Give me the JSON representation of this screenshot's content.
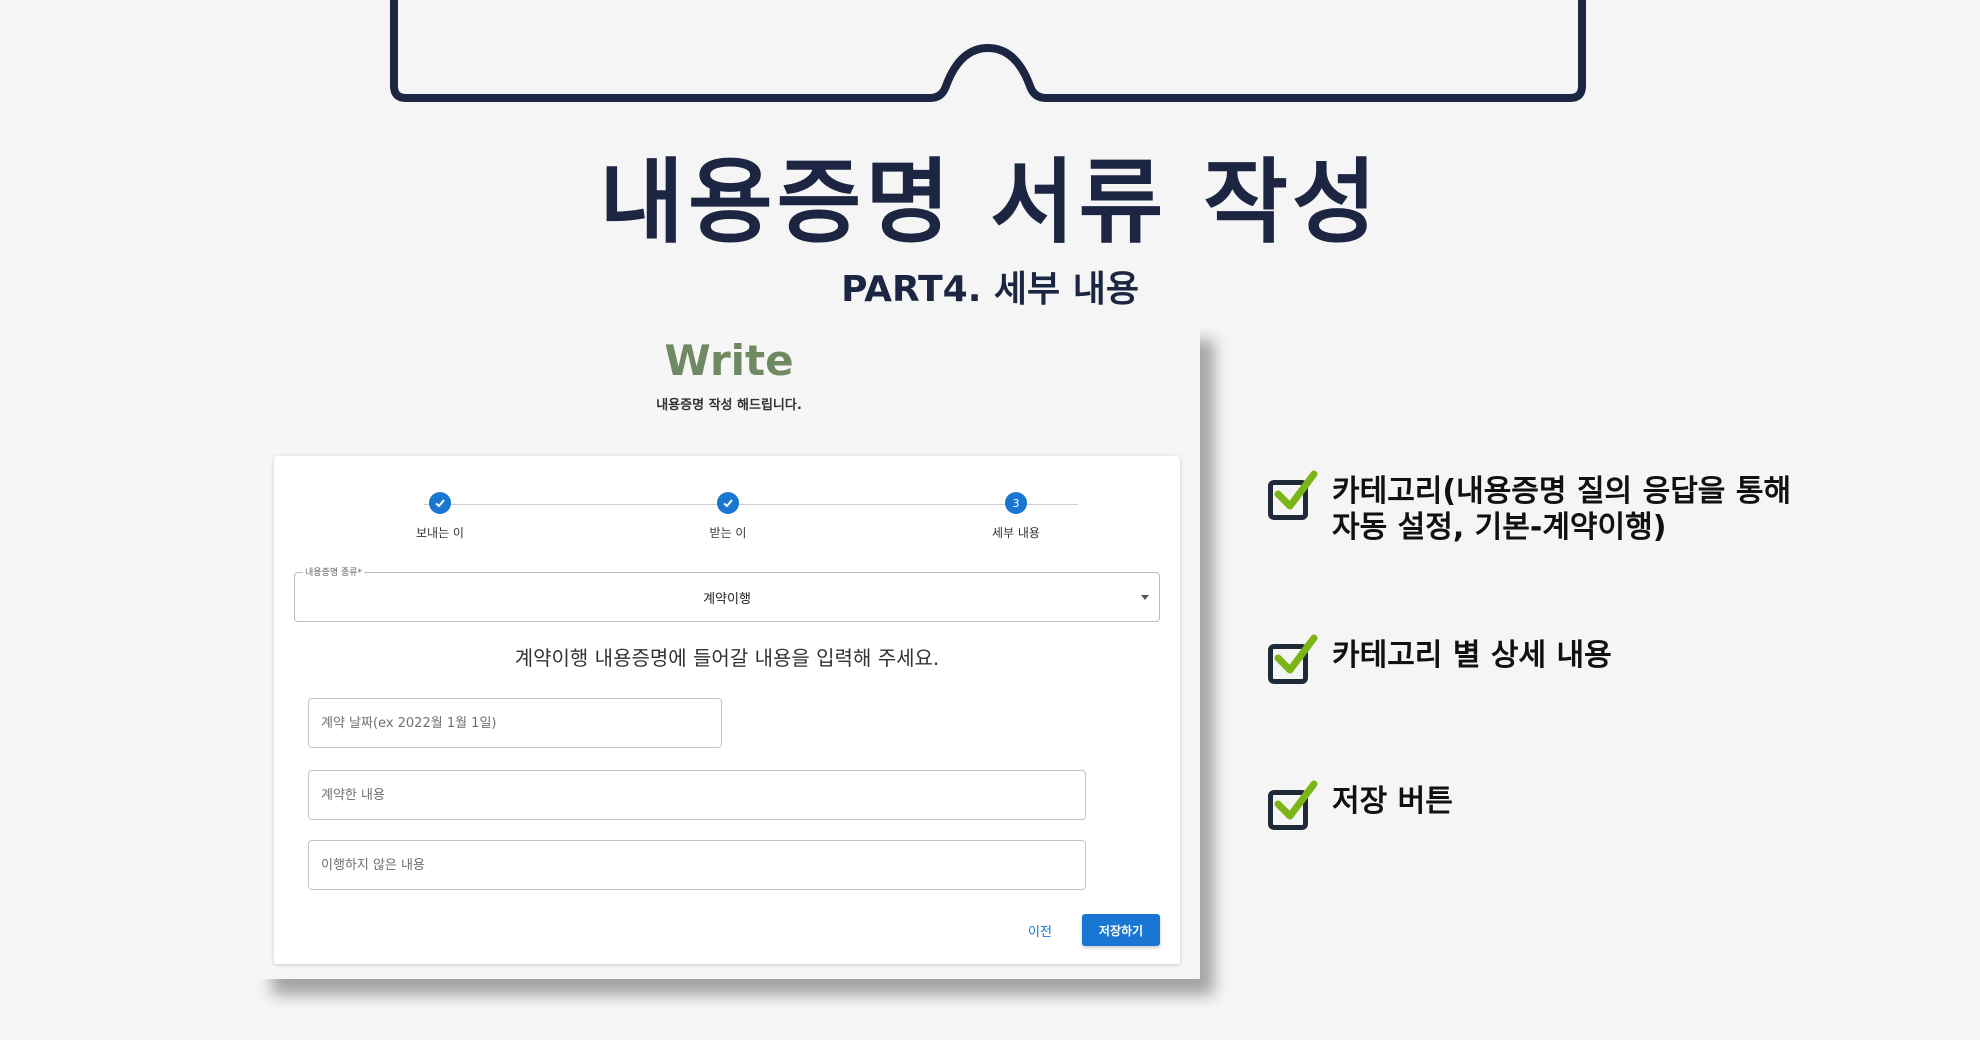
{
  "slide": {
    "title": "내용증명 서류 작성",
    "subtitle": "PART4. 세부 내용"
  },
  "app": {
    "brand": "Write",
    "tagline": "내용증명 작성 해드립니다."
  },
  "stepper": {
    "steps": [
      {
        "label": "보내는 이",
        "status": "completed"
      },
      {
        "label": "받는 이",
        "status": "completed"
      },
      {
        "label": "세부 내용",
        "status": "active",
        "number": "3"
      }
    ]
  },
  "form": {
    "type_select": {
      "label": "내용증명 종류*",
      "value": "계약이행"
    },
    "prompt": "계약이행 내용증명에 들어갈 내용을 입력해 주세요.",
    "fields": [
      {
        "placeholder": "계약 날짜(ex 2022월 1월 1일)"
      },
      {
        "placeholder": "계약한 내용"
      },
      {
        "placeholder": "이행하지 않은 내용"
      }
    ],
    "prev_label": "이전",
    "save_label": "저장하기"
  },
  "checklist": [
    {
      "text": "카테고리(내용증명 질의 응답을 통해\n자동 설정, 기본-계약이행)",
      "icon": "checkbox-checked-icon"
    },
    {
      "text": "카테고리 별 상세 내용",
      "icon": "checkbox-checked-icon"
    },
    {
      "text": "저장 버튼",
      "icon": "checkbox-checked-icon"
    }
  ],
  "colors": {
    "navy": "#1c2541",
    "brand_green": "#6f8a62",
    "primary_blue": "#1976d2",
    "check_green": "#7cb518"
  }
}
